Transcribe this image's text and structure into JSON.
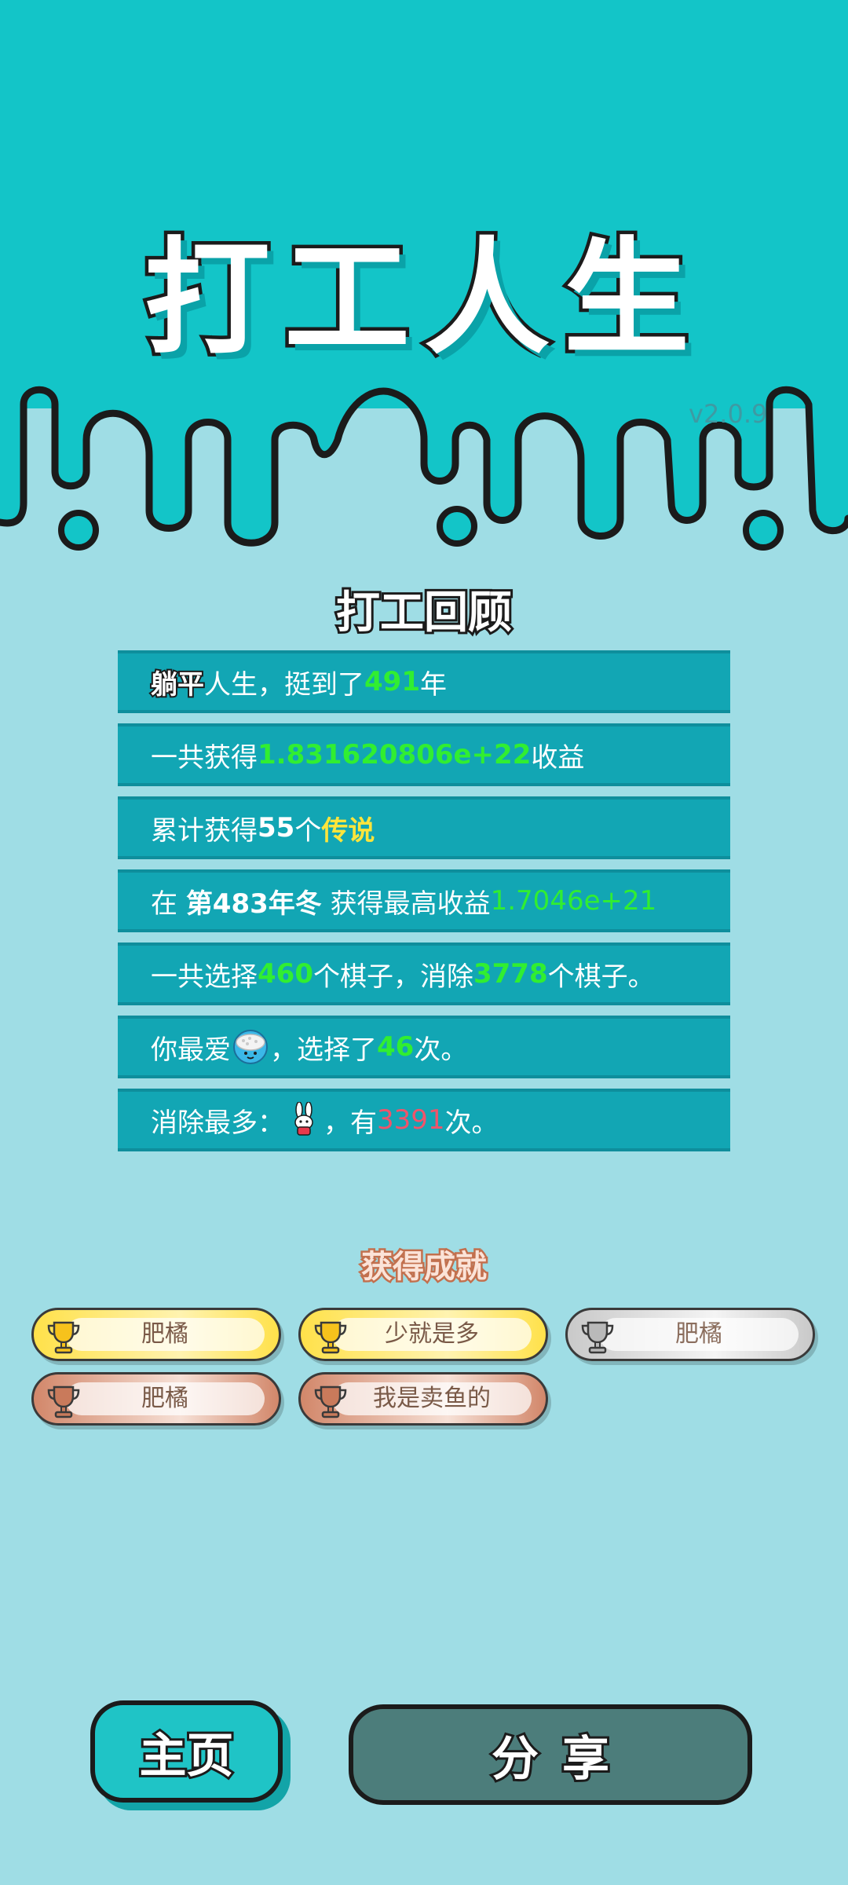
{
  "header": {
    "title": "打工人生",
    "version": "v2.0.9",
    "bg_color": "#13c5c8",
    "drip_color": "#13c5c8"
  },
  "review": {
    "title": "打工回顾",
    "rows": [
      {
        "a": "躺平",
        "b": "人生，挺到了",
        "c": "491",
        "d": "年"
      },
      {
        "a": "一共获得",
        "b": "1.831620806e+22",
        "c": "收益"
      },
      {
        "a": "累计获得",
        "b": "55",
        "c": "个",
        "d": "传说"
      },
      {
        "a": "在 ",
        "b": "第483年冬",
        "c": " 获得最高收益",
        "d": "1.7046e+21"
      },
      {
        "a": "一共选择",
        "b": "460",
        "c": "个棋子，消除",
        "d": "3778",
        "e": "个棋子。"
      },
      {
        "a": "你最爱",
        "icon": "rice-bowl-icon",
        "b": "，选择了",
        "c": "46",
        "d": "次。"
      },
      {
        "a": "消除最多：",
        "icon": "rabbit-icon",
        "b": "，有",
        "c": "3391",
        "d": "次。"
      }
    ]
  },
  "achievements": {
    "title": "获得成就",
    "items": [
      {
        "label": "肥橘",
        "tier": "gold"
      },
      {
        "label": "少就是多",
        "tier": "gold"
      },
      {
        "label": "肥橘",
        "tier": "silver"
      },
      {
        "label": "肥橘",
        "tier": "bronze"
      },
      {
        "label": "我是卖鱼的",
        "tier": "bronze"
      }
    ]
  },
  "buttons": {
    "home": "主页",
    "share": "分享"
  },
  "colors": {
    "green_value": "#31ee31",
    "yellow_value": "#ffe53b",
    "red_value": "#f0546a",
    "row_bg": "#12a6b4"
  }
}
